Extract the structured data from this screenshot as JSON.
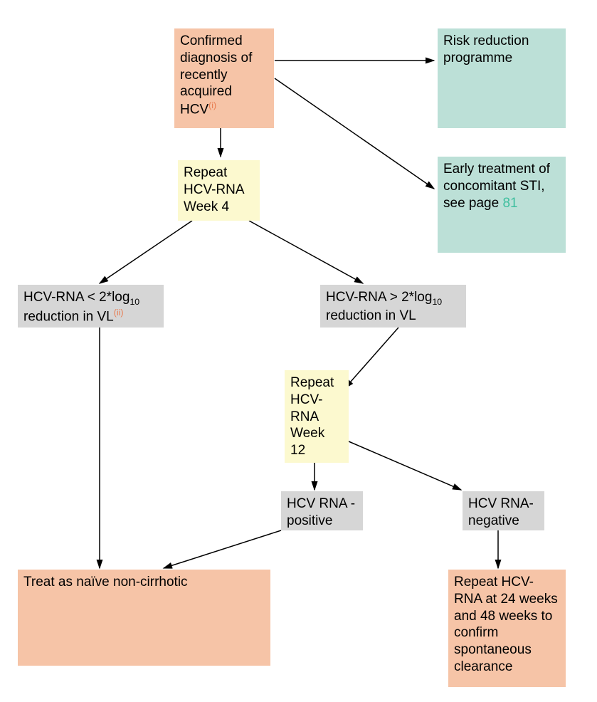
{
  "boxes": {
    "confirmed_prefix": "Confirmed diagnosis of recently acquired HCV",
    "confirmed_note": "(i)",
    "risk_reduction": "Risk reduction programme",
    "early_treat_prefix": "Early treatment of concomitant STI, see page ",
    "early_treat_page": "81",
    "repeat_wk4": "Repeat HCV-RNA Week 4",
    "lt2log_a": " HCV-RNA < 2*log",
    "lt2log_sub": "10",
    "lt2log_b": " reduction in VL",
    "lt2log_note": "(ii)",
    "gt2log_a": " HCV-RNA > 2*log",
    "gt2log_b": " reduction in VL",
    "repeat_wk12": "Repeat HCV-RNA Week 12",
    "rna_positive": "HCV RNA -positive",
    "rna_negative": "HCV RNA-negative",
    "treat_naive": "Treat as naïve non-cirrhotic",
    "repeat_confirm": "Repeat HCV-RNA at 24 weeks and 48 weeks to confirm spontaneous clearance"
  },
  "colors": {
    "peach": "#f6c4a7",
    "teal": "#bce0d7",
    "yellow": "#fcf9cf",
    "gray": "#d6d6d6",
    "accent_green": "#3fbf9f",
    "accent_orange": "#e87b4f"
  },
  "chart_data": {
    "type": "flowchart",
    "nodes": [
      {
        "id": "confirmed",
        "label": "Confirmed diagnosis of recently acquired HCV(i)",
        "color": "peach"
      },
      {
        "id": "risk",
        "label": "Risk reduction programme",
        "color": "teal"
      },
      {
        "id": "early",
        "label": "Early treatment of concomitant STI, see page 81",
        "color": "teal"
      },
      {
        "id": "wk4",
        "label": "Repeat HCV-RNA Week 4",
        "color": "yellow"
      },
      {
        "id": "lt2",
        "label": "HCV-RNA < 2*log10 reduction in VL(ii)",
        "color": "gray"
      },
      {
        "id": "gt2",
        "label": "HCV-RNA > 2*log10 reduction in VL",
        "color": "gray"
      },
      {
        "id": "wk12",
        "label": "Repeat HCV-RNA Week 12",
        "color": "yellow"
      },
      {
        "id": "pos",
        "label": "HCV RNA -positive",
        "color": "gray"
      },
      {
        "id": "neg",
        "label": "HCV RNA-negative",
        "color": "gray"
      },
      {
        "id": "treat",
        "label": "Treat as naïve non-cirrhotic",
        "color": "peach"
      },
      {
        "id": "confirm",
        "label": "Repeat HCV-RNA at 24 weeks and 48 weeks to confirm spontaneous clearance",
        "color": "peach"
      }
    ],
    "edges": [
      [
        "confirmed",
        "risk"
      ],
      [
        "confirmed",
        "early"
      ],
      [
        "confirmed",
        "wk4"
      ],
      [
        "wk4",
        "lt2"
      ],
      [
        "wk4",
        "gt2"
      ],
      [
        "lt2",
        "treat"
      ],
      [
        "gt2",
        "wk12"
      ],
      [
        "wk12",
        "pos"
      ],
      [
        "wk12",
        "neg"
      ],
      [
        "pos",
        "treat"
      ],
      [
        "neg",
        "confirm"
      ]
    ]
  }
}
